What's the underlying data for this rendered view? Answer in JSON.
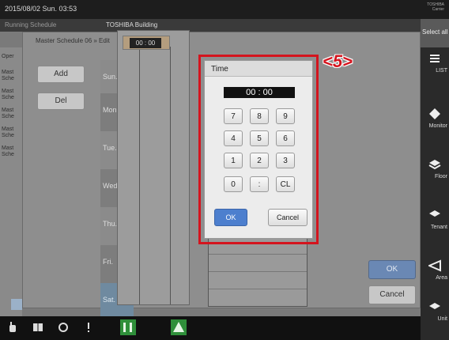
{
  "topbar": {
    "datetime": "2015/08/02  Sun.  03:53",
    "logo": "TOSHIBA\nCarrier"
  },
  "titlerow": {
    "screen": "Running Schedule",
    "building": "TOSHIBA Building",
    "select_all": "Select all"
  },
  "leftlist": {
    "items": [
      "Oper",
      "Mast\nSche",
      "Mast\nSche",
      "Mast\nSche",
      "Mast\nSche",
      "Mast\nSche"
    ]
  },
  "dialog": {
    "title": "Master Schedule 06 » Edit",
    "add_label": "Add",
    "del_label": "Del",
    "days": [
      "Sun.",
      "Mon.",
      "Tue.",
      "Wed.",
      "Thu.",
      "Fri.",
      "Sat."
    ],
    "time_chip": "00 : 00",
    "ok_label": "OK",
    "cancel_label": "Cancel"
  },
  "time_popup": {
    "title": "Time",
    "display": "00 : 00",
    "keys": [
      "7",
      "8",
      "9",
      "4",
      "5",
      "6",
      "1",
      "2",
      "3",
      "0",
      ":",
      "CL"
    ],
    "ok_label": "OK",
    "cancel_label": "Cancel"
  },
  "annotation": {
    "marker": "<5>"
  },
  "rightcol": {
    "items": [
      "LIST",
      "Monitor",
      "Floor",
      "Tenant",
      "Area",
      "Unit"
    ]
  },
  "colors": {
    "highlight": "#d4141e",
    "ok_blue": "#4d7fce"
  }
}
